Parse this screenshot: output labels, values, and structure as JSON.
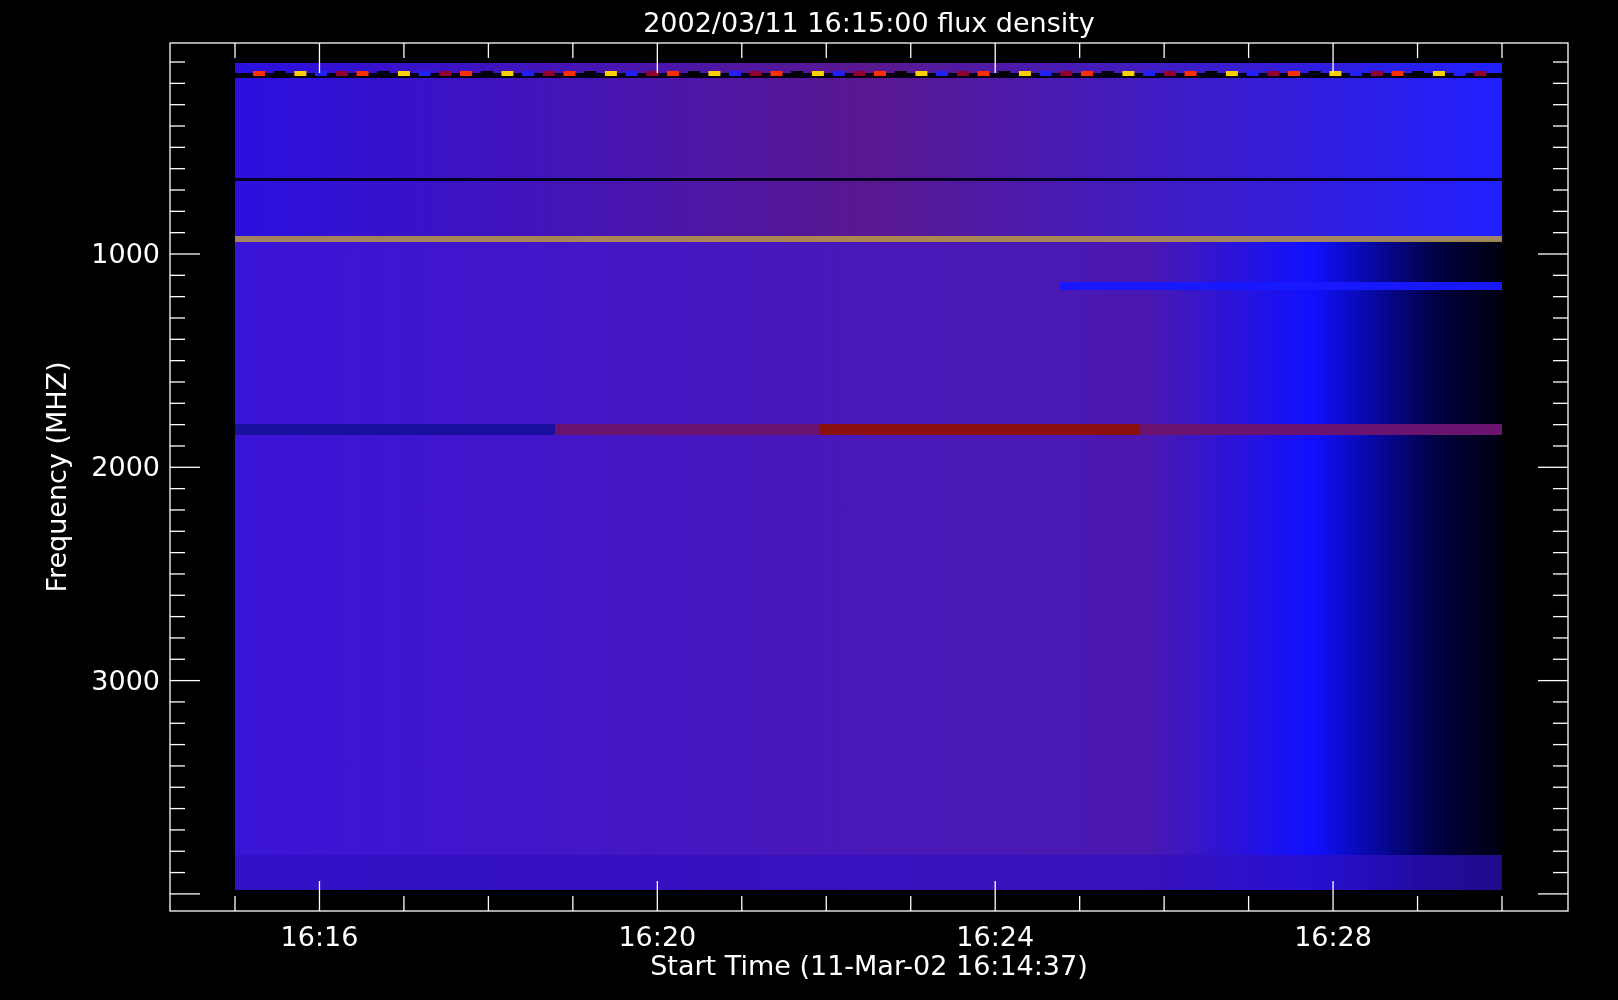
{
  "title": "2002/03/11 16:15:00 flux density",
  "y_axis": {
    "label": "Frequency (MHZ)",
    "ticks": [
      "1000",
      "2000",
      "3000"
    ]
  },
  "x_axis": {
    "label": "Start Time (11-Mar-02 16:14:37)",
    "ticks": [
      "16:16",
      "16:20",
      "16:24",
      "16:28"
    ]
  }
}
